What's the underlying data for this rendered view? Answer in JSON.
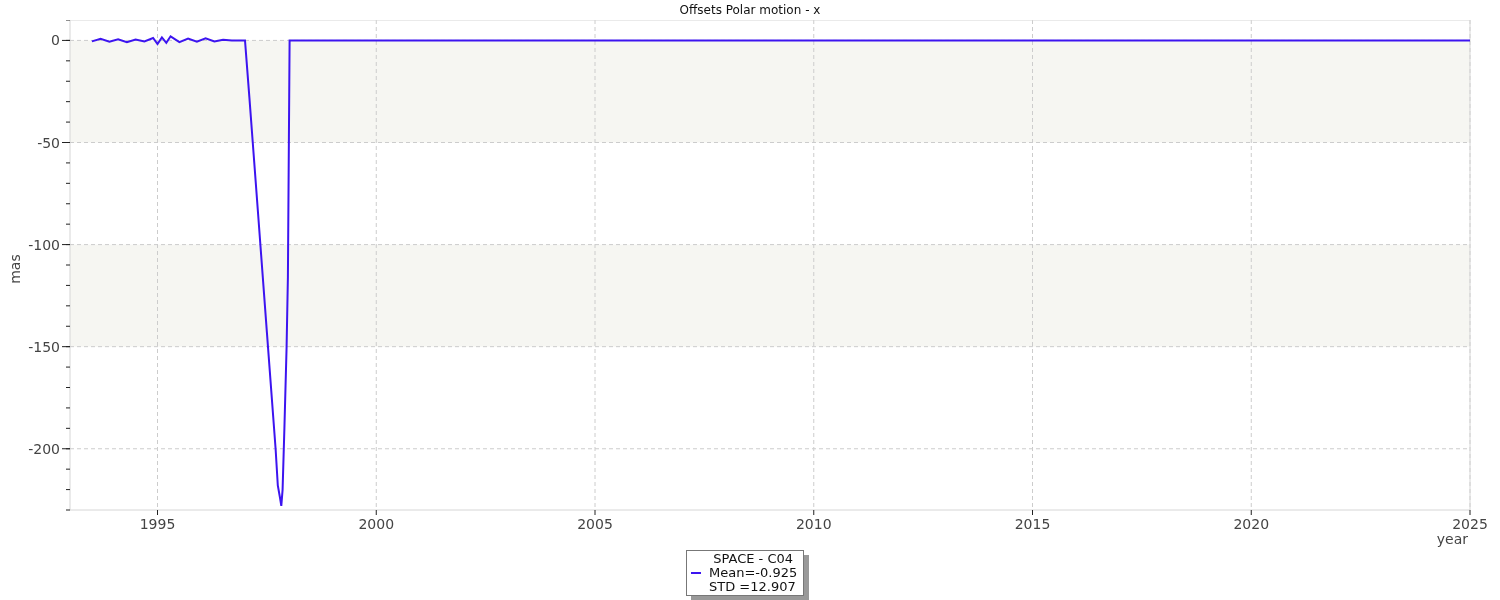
{
  "chart": {
    "chart_data": {
      "type": "line",
      "title": "Offsets Polar motion - x",
      "xlabel": "year",
      "ylabel": "mas",
      "x": [
        1993.5,
        1993.7,
        1993.9,
        1994.1,
        1994.3,
        1994.5,
        1994.7,
        1994.9,
        1995.0,
        1995.1,
        1995.2,
        1995.3,
        1995.5,
        1995.7,
        1995.9,
        1996.1,
        1996.3,
        1996.5,
        1996.7,
        1997.0,
        1997.1,
        1997.3,
        1997.5,
        1997.7,
        1997.75,
        1997.8,
        1997.83,
        1997.86,
        1997.9,
        1997.95,
        1997.98,
        1998.02,
        1998.5,
        2000,
        2005,
        2010,
        2015,
        2020,
        2025
      ],
      "series": [
        {
          "name": "SPACE - C04",
          "color": "#3c14f0",
          "values": [
            -0.5,
            0.8,
            -0.6,
            0.5,
            -0.8,
            0.4,
            -0.5,
            1.2,
            -1.8,
            1.5,
            -1.2,
            2.0,
            -0.8,
            0.9,
            -0.6,
            1.0,
            -0.5,
            0.3,
            0,
            0,
            -28,
            -85,
            -143,
            -200,
            -218,
            -224,
            -228,
            -220,
            -190,
            -150,
            -116,
            0,
            0,
            0,
            0,
            0,
            0,
            0,
            0
          ]
        }
      ],
      "grid": true,
      "xlim": [
        1993,
        2025
      ],
      "ylim": [
        -230,
        10
      ],
      "xticks": [
        1995,
        2000,
        2005,
        2010,
        2015,
        2020,
        2025
      ],
      "yticks": [
        0,
        -50,
        -100,
        -150,
        -200
      ]
    },
    "legend": {
      "mean": "Mean=-0.925",
      "std": "STD =12.907"
    }
  }
}
